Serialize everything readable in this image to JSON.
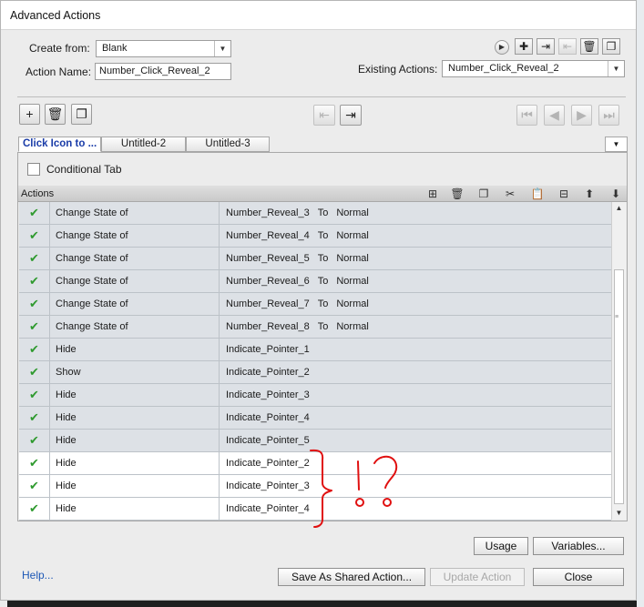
{
  "window": {
    "title": "Advanced Actions"
  },
  "top": {
    "create_from_label": "Create from:",
    "create_from_value": "Blank",
    "action_name_label": "Action Name:",
    "action_name_value": "Number_Click_Reveal_2",
    "existing_actions_label": "Existing Actions:",
    "existing_actions_value": "Number_Click_Reveal_2",
    "icons": [
      "preview-icon",
      "new-action-icon",
      "import-icon",
      "export-icon",
      "delete-action-icon",
      "duplicate-action-icon"
    ]
  },
  "tabs": [
    {
      "label": "Click Icon to ..."
    },
    {
      "label": "Untitled-2"
    },
    {
      "label": "Untitled-3"
    }
  ],
  "conditional_tab_label": "Conditional Tab",
  "conditional_tab_checked": false,
  "actions_header": "Actions",
  "actions": [
    {
      "status": "✔",
      "action": "Change State of",
      "object": "Number_Reveal_3",
      "to": "To",
      "state": "Normal",
      "highlighted": true
    },
    {
      "status": "✔",
      "action": "Change State of",
      "object": "Number_Reveal_4",
      "to": "To",
      "state": "Normal",
      "highlighted": true
    },
    {
      "status": "✔",
      "action": "Change State of",
      "object": "Number_Reveal_5",
      "to": "To",
      "state": "Normal",
      "highlighted": true
    },
    {
      "status": "✔",
      "action": "Change State of",
      "object": "Number_Reveal_6",
      "to": "To",
      "state": "Normal",
      "highlighted": true
    },
    {
      "status": "✔",
      "action": "Change State of",
      "object": "Number_Reveal_7",
      "to": "To",
      "state": "Normal",
      "highlighted": true
    },
    {
      "status": "✔",
      "action": "Change State of",
      "object": "Number_Reveal_8",
      "to": "To",
      "state": "Normal",
      "highlighted": true
    },
    {
      "status": "✔",
      "action": "Hide",
      "object": "Indicate_Pointer_1",
      "to": "",
      "state": "",
      "highlighted": true
    },
    {
      "status": "✔",
      "action": "Show",
      "object": "Indicate_Pointer_2",
      "to": "",
      "state": "",
      "highlighted": true
    },
    {
      "status": "✔",
      "action": "Hide",
      "object": "Indicate_Pointer_3",
      "to": "",
      "state": "",
      "highlighted": true
    },
    {
      "status": "✔",
      "action": "Hide",
      "object": "Indicate_Pointer_4",
      "to": "",
      "state": "",
      "highlighted": true
    },
    {
      "status": "✔",
      "action": "Hide",
      "object": "Indicate_Pointer_5",
      "to": "",
      "state": "",
      "highlighted": true
    },
    {
      "status": "✔",
      "action": "Hide",
      "object": "Indicate_Pointer_2",
      "to": "",
      "state": "",
      "highlighted": false
    },
    {
      "status": "✔",
      "action": "Hide",
      "object": "Indicate_Pointer_3",
      "to": "",
      "state": "",
      "highlighted": false
    },
    {
      "status": "✔",
      "action": "Hide",
      "object": "Indicate_Pointer_4",
      "to": "",
      "state": "",
      "highlighted": false
    }
  ],
  "annotation_color": "#e01010",
  "buttons": {
    "usage": "Usage",
    "variables": "Variables...",
    "help": "Help...",
    "save_shared": "Save As Shared Action...",
    "update": "Update Action",
    "close": "Close"
  },
  "colors": {
    "check": "#2f9a2f",
    "active_tab_text": "#1a3ca8",
    "link": "#1e58b6",
    "selected_row": "#dde1e6"
  }
}
